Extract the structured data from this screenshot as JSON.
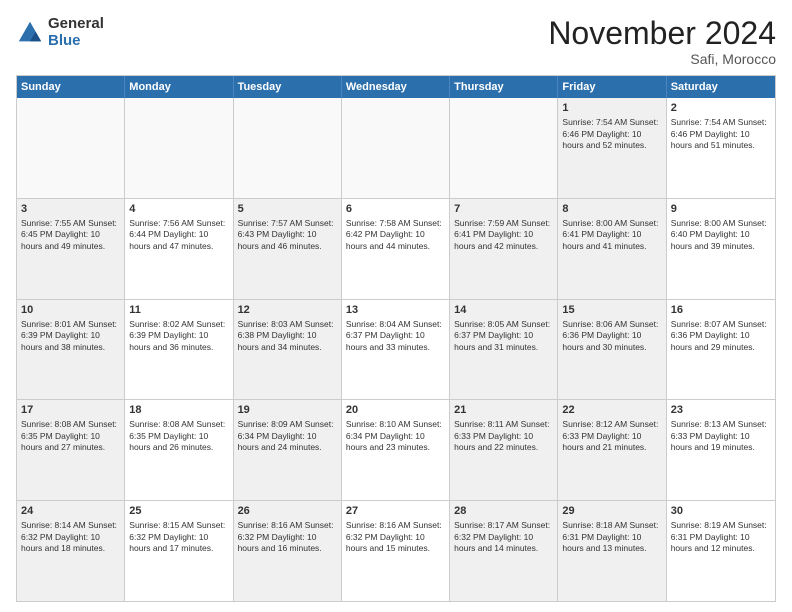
{
  "logo": {
    "general": "General",
    "blue": "Blue"
  },
  "header": {
    "month": "November 2024",
    "location": "Safi, Morocco"
  },
  "weekdays": [
    "Sunday",
    "Monday",
    "Tuesday",
    "Wednesday",
    "Thursday",
    "Friday",
    "Saturday"
  ],
  "rows": [
    [
      {
        "day": "",
        "text": "",
        "empty": true
      },
      {
        "day": "",
        "text": "",
        "empty": true
      },
      {
        "day": "",
        "text": "",
        "empty": true
      },
      {
        "day": "",
        "text": "",
        "empty": true
      },
      {
        "day": "",
        "text": "",
        "empty": true
      },
      {
        "day": "1",
        "text": "Sunrise: 7:54 AM\nSunset: 6:46 PM\nDaylight: 10 hours\nand 52 minutes.",
        "shaded": true
      },
      {
        "day": "2",
        "text": "Sunrise: 7:54 AM\nSunset: 6:46 PM\nDaylight: 10 hours\nand 51 minutes.",
        "shaded": false
      }
    ],
    [
      {
        "day": "3",
        "text": "Sunrise: 7:55 AM\nSunset: 6:45 PM\nDaylight: 10 hours\nand 49 minutes.",
        "shaded": true
      },
      {
        "day": "4",
        "text": "Sunrise: 7:56 AM\nSunset: 6:44 PM\nDaylight: 10 hours\nand 47 minutes.",
        "shaded": false
      },
      {
        "day": "5",
        "text": "Sunrise: 7:57 AM\nSunset: 6:43 PM\nDaylight: 10 hours\nand 46 minutes.",
        "shaded": true
      },
      {
        "day": "6",
        "text": "Sunrise: 7:58 AM\nSunset: 6:42 PM\nDaylight: 10 hours\nand 44 minutes.",
        "shaded": false
      },
      {
        "day": "7",
        "text": "Sunrise: 7:59 AM\nSunset: 6:41 PM\nDaylight: 10 hours\nand 42 minutes.",
        "shaded": true
      },
      {
        "day": "8",
        "text": "Sunrise: 8:00 AM\nSunset: 6:41 PM\nDaylight: 10 hours\nand 41 minutes.",
        "shaded": true
      },
      {
        "day": "9",
        "text": "Sunrise: 8:00 AM\nSunset: 6:40 PM\nDaylight: 10 hours\nand 39 minutes.",
        "shaded": false
      }
    ],
    [
      {
        "day": "10",
        "text": "Sunrise: 8:01 AM\nSunset: 6:39 PM\nDaylight: 10 hours\nand 38 minutes.",
        "shaded": true
      },
      {
        "day": "11",
        "text": "Sunrise: 8:02 AM\nSunset: 6:39 PM\nDaylight: 10 hours\nand 36 minutes.",
        "shaded": false
      },
      {
        "day": "12",
        "text": "Sunrise: 8:03 AM\nSunset: 6:38 PM\nDaylight: 10 hours\nand 34 minutes.",
        "shaded": true
      },
      {
        "day": "13",
        "text": "Sunrise: 8:04 AM\nSunset: 6:37 PM\nDaylight: 10 hours\nand 33 minutes.",
        "shaded": false
      },
      {
        "day": "14",
        "text": "Sunrise: 8:05 AM\nSunset: 6:37 PM\nDaylight: 10 hours\nand 31 minutes.",
        "shaded": true
      },
      {
        "day": "15",
        "text": "Sunrise: 8:06 AM\nSunset: 6:36 PM\nDaylight: 10 hours\nand 30 minutes.",
        "shaded": true
      },
      {
        "day": "16",
        "text": "Sunrise: 8:07 AM\nSunset: 6:36 PM\nDaylight: 10 hours\nand 29 minutes.",
        "shaded": false
      }
    ],
    [
      {
        "day": "17",
        "text": "Sunrise: 8:08 AM\nSunset: 6:35 PM\nDaylight: 10 hours\nand 27 minutes.",
        "shaded": true
      },
      {
        "day": "18",
        "text": "Sunrise: 8:08 AM\nSunset: 6:35 PM\nDaylight: 10 hours\nand 26 minutes.",
        "shaded": false
      },
      {
        "day": "19",
        "text": "Sunrise: 8:09 AM\nSunset: 6:34 PM\nDaylight: 10 hours\nand 24 minutes.",
        "shaded": true
      },
      {
        "day": "20",
        "text": "Sunrise: 8:10 AM\nSunset: 6:34 PM\nDaylight: 10 hours\nand 23 minutes.",
        "shaded": false
      },
      {
        "day": "21",
        "text": "Sunrise: 8:11 AM\nSunset: 6:33 PM\nDaylight: 10 hours\nand 22 minutes.",
        "shaded": true
      },
      {
        "day": "22",
        "text": "Sunrise: 8:12 AM\nSunset: 6:33 PM\nDaylight: 10 hours\nand 21 minutes.",
        "shaded": true
      },
      {
        "day": "23",
        "text": "Sunrise: 8:13 AM\nSunset: 6:33 PM\nDaylight: 10 hours\nand 19 minutes.",
        "shaded": false
      }
    ],
    [
      {
        "day": "24",
        "text": "Sunrise: 8:14 AM\nSunset: 6:32 PM\nDaylight: 10 hours\nand 18 minutes.",
        "shaded": true
      },
      {
        "day": "25",
        "text": "Sunrise: 8:15 AM\nSunset: 6:32 PM\nDaylight: 10 hours\nand 17 minutes.",
        "shaded": false
      },
      {
        "day": "26",
        "text": "Sunrise: 8:16 AM\nSunset: 6:32 PM\nDaylight: 10 hours\nand 16 minutes.",
        "shaded": true
      },
      {
        "day": "27",
        "text": "Sunrise: 8:16 AM\nSunset: 6:32 PM\nDaylight: 10 hours\nand 15 minutes.",
        "shaded": false
      },
      {
        "day": "28",
        "text": "Sunrise: 8:17 AM\nSunset: 6:32 PM\nDaylight: 10 hours\nand 14 minutes.",
        "shaded": true
      },
      {
        "day": "29",
        "text": "Sunrise: 8:18 AM\nSunset: 6:31 PM\nDaylight: 10 hours\nand 13 minutes.",
        "shaded": true
      },
      {
        "day": "30",
        "text": "Sunrise: 8:19 AM\nSunset: 6:31 PM\nDaylight: 10 hours\nand 12 minutes.",
        "shaded": false
      }
    ]
  ]
}
